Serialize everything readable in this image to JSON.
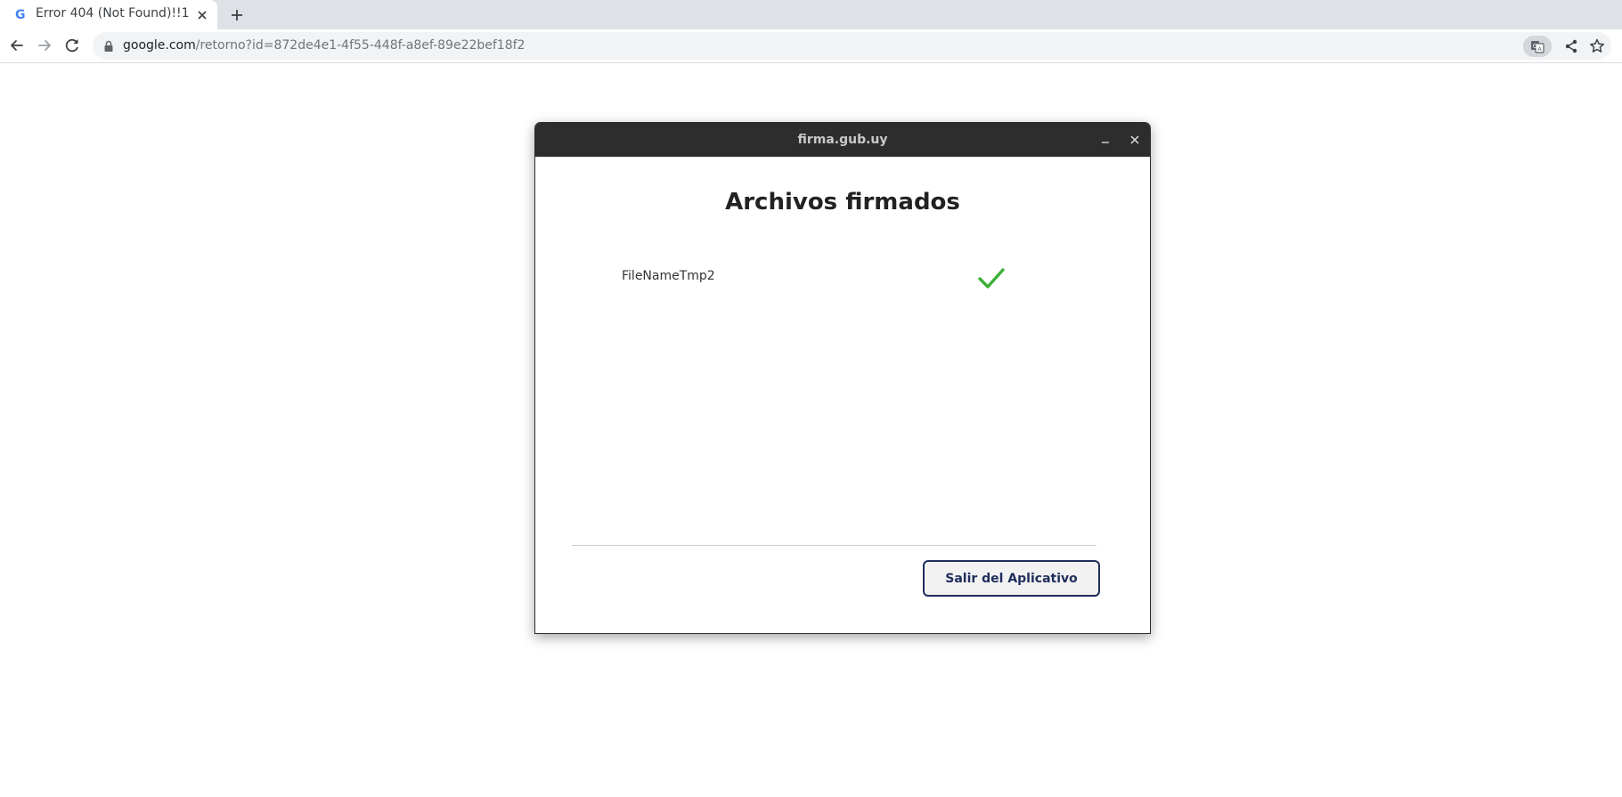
{
  "browser": {
    "tab": {
      "title": "Error 404 (Not Found)!!1",
      "favicon": "google-g-icon"
    },
    "omnibox": {
      "url_host": "google.com",
      "url_path": "/retorno?id=872de4e1-4f55-448f-a8ef-89e22bef18f2"
    },
    "icons": {
      "back": "back-arrow-icon",
      "forward": "forward-arrow-icon",
      "reload": "reload-icon",
      "lock": "lock-icon",
      "translate": "translate-icon",
      "share": "share-icon",
      "bookmark": "star-icon",
      "new_tab": "plus-icon",
      "close_tab": "close-icon"
    }
  },
  "dialog": {
    "window_title": "firma.gub.uy",
    "heading": "Archivos firmados",
    "files": [
      {
        "name": "FileNameTmp2",
        "status": "signed",
        "status_icon": "checkmark-icon"
      }
    ],
    "exit_button": "Salir del Aplicativo",
    "colors": {
      "titlebar": "#2d2d2d",
      "check": "#3db036",
      "button_border": "#1f2d5c"
    }
  }
}
